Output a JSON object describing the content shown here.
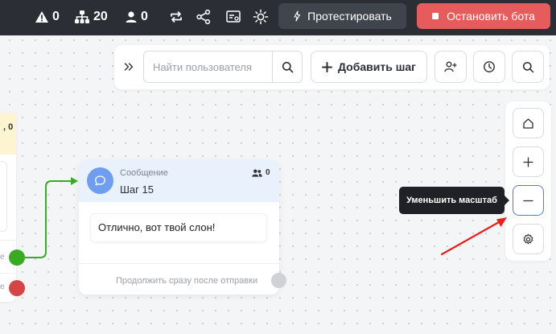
{
  "topbar": {
    "warnings_count": "0",
    "users_count": "20",
    "person_count": "0",
    "test_button": "Протестировать",
    "stop_button": "Остановить бота"
  },
  "toolbar": {
    "search_placeholder": "Найти пользователя",
    "search_value": "",
    "add_step_label": "Добавить шаг"
  },
  "right_panel": {
    "tooltip": "Уменьшить масштаб"
  },
  "left_card": {
    "count": ", 0",
    "edge_label_1": "e",
    "edge_label_2": "e"
  },
  "step": {
    "type_label": "Сообщение",
    "title": "Шаг 15",
    "users_count": "0",
    "message_text": "Отлично, вот твой слон!",
    "footer_text": "Продолжить сразу после отправки"
  },
  "colors": {
    "topbar_bg": "#2b2e35",
    "stop_button_bg": "#e65b5b",
    "test_button_bg": "#40444d",
    "step_header_bg": "#e9f1fd",
    "connection_green": "#3aa923",
    "connection_red": "#d64545",
    "annotation_arrow": "#e8201f",
    "active_border": "#4a7fd6"
  },
  "icons": {
    "warnings": "warning-icon",
    "users": "hierarchy-icon",
    "person": "person-icon",
    "repeat": "repeat-icon",
    "share": "share-icon",
    "variables": "variables-icon",
    "theme": "sun-icon",
    "test": "lightning-icon",
    "stop": "stop-icon",
    "collapse": "chevrons-right-icon",
    "search": "search-icon",
    "add": "plus-icon",
    "add_user": "add-user-icon",
    "history": "clock-icon",
    "find": "search-icon",
    "home": "home-icon",
    "zoom_in": "plus-icon",
    "zoom_out": "minus-icon",
    "settings": "gear-icon",
    "message": "chat-bubble-icon",
    "users_small": "users-icon"
  }
}
